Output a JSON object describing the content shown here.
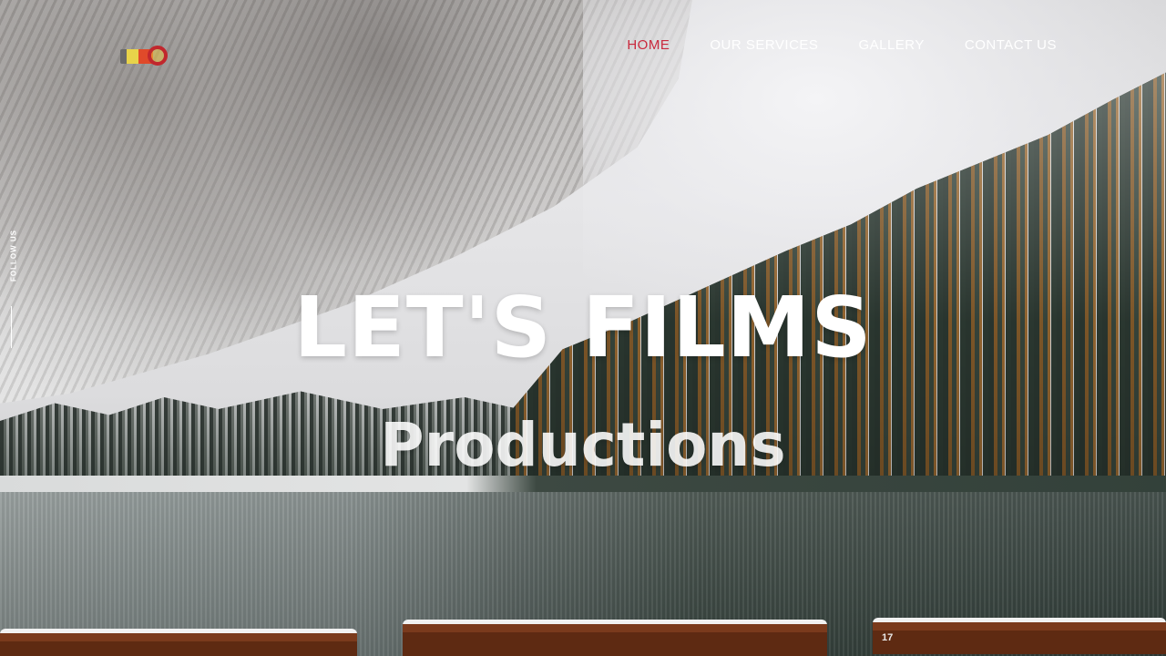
{
  "brand": {
    "logo_icon": "eye-film-logo-icon"
  },
  "nav": {
    "items": [
      {
        "label": "HOME",
        "active": true
      },
      {
        "label": "OUR SERVICES",
        "active": false
      },
      {
        "label": "GALLERY",
        "active": false
      },
      {
        "label": "CONTACT US",
        "active": false
      }
    ],
    "active_color": "#c9283c",
    "text_color": "#ffffff"
  },
  "social": {
    "follow_label": "FOLLOW US"
  },
  "hero": {
    "title": "LET'S FILMS",
    "subtitle": "Productions",
    "boat_number": "17"
  }
}
